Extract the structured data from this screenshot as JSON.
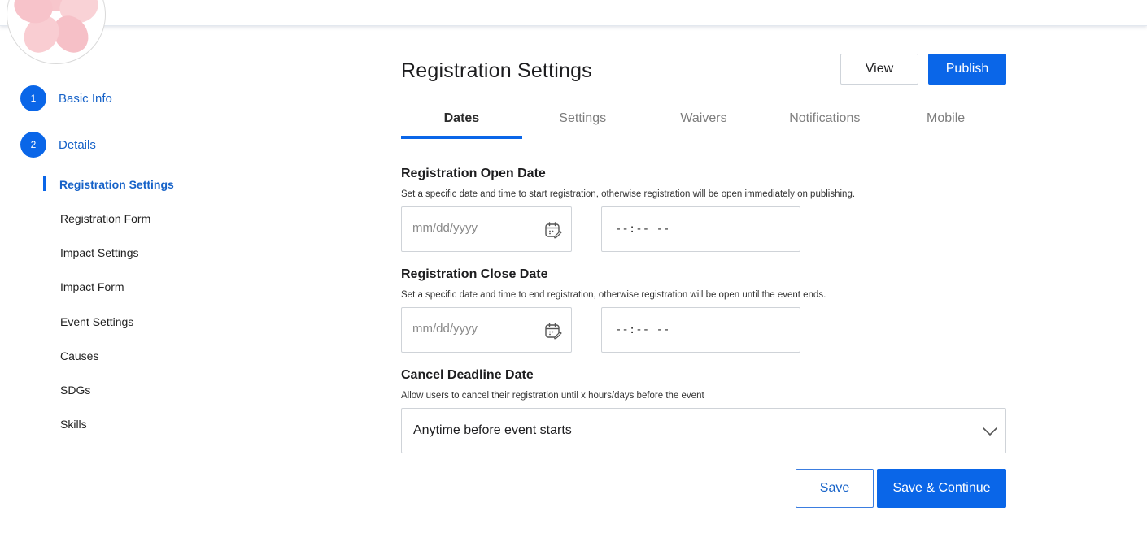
{
  "sidebar": {
    "steps": [
      {
        "number": "1",
        "label": "Basic Info"
      },
      {
        "number": "2",
        "label": "Details"
      }
    ],
    "sub_items": [
      "Registration Settings",
      "Registration Form",
      "Impact Settings",
      "Impact Form",
      "Event Settings",
      "Causes",
      "SDGs",
      "Skills"
    ]
  },
  "header": {
    "title": "Registration Settings",
    "view_label": "View",
    "publish_label": "Publish"
  },
  "tabs": [
    "Dates",
    "Settings",
    "Waivers",
    "Notifications",
    "Mobile"
  ],
  "sections": {
    "open": {
      "title": "Registration Open Date",
      "description": "Set a specific date and time to start registration, otherwise registration will be open immediately on publishing.",
      "date_placeholder": "mm/dd/yyyy",
      "time_value": "--:-- --"
    },
    "close": {
      "title": "Registration Close Date",
      "description": "Set a specific date and time to end registration, otherwise registration will be open until the event ends.",
      "date_placeholder": "mm/dd/yyyy",
      "time_value": "--:-- --"
    },
    "cancel": {
      "title": "Cancel Deadline Date",
      "description": "Allow users to cancel their registration until x hours/days before the event",
      "selected": "Anytime before event starts"
    }
  },
  "footer": {
    "save_label": "Save",
    "continue_label": "Save & Continue"
  },
  "colors": {
    "accent": "#0a66e8",
    "link": "#1662c8"
  }
}
